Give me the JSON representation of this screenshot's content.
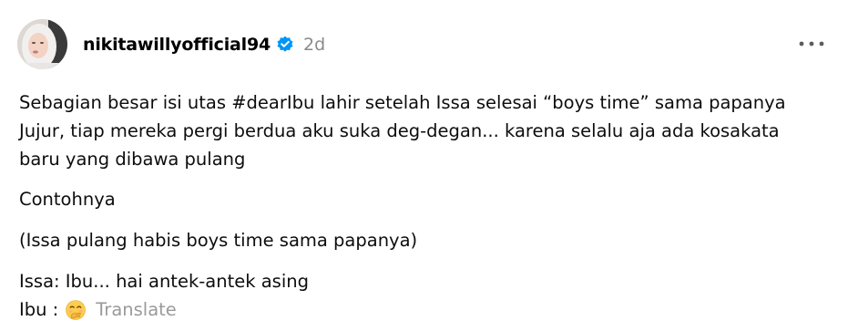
{
  "post": {
    "author": {
      "username": "nikitawillyofficial94",
      "verified": true,
      "verified_icon": "verified-badge-icon",
      "avatar_icon": "avatar"
    },
    "timestamp": "2d",
    "more_icon": "more-options-icon",
    "body": {
      "paragraph1": {
        "lines": [
          "Sebagian besar isi utas #dearIbu lahir setelah Issa selesai “boys time” sama papanya",
          "Jujur, tiap mereka pergi berdua aku suka deg-degan... karena selalu aja ada kosakata",
          "baru yang dibawa pulang"
        ]
      },
      "paragraph2": "Contohnya",
      "paragraph3": "(Issa pulang habis boys time sama papanya)",
      "paragraph4": "Issa: Ibu... hai antek-antek asing",
      "paragraph5_prefix": "Ibu :",
      "paragraph5_emoji": "face-with-hand-over-mouth-icon",
      "translate_label": "Translate"
    },
    "colors": {
      "verified_blue": "#0095f6",
      "muted_gray": "#8a8a8a",
      "text": "#0d0d0d"
    }
  }
}
